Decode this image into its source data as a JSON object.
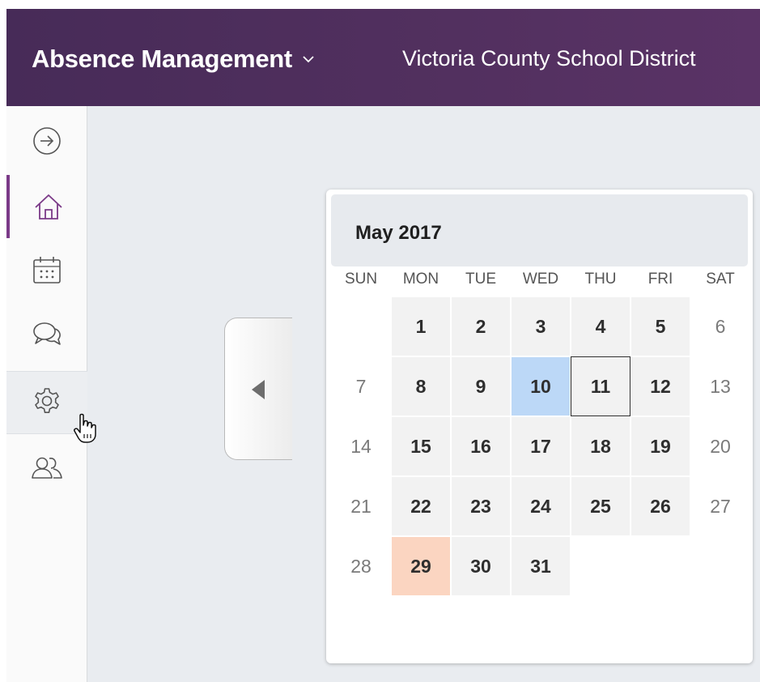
{
  "header": {
    "app_title": "Absence Management",
    "district": "Victoria County School District"
  },
  "sidebar": {
    "items": [
      {
        "icon": "arrow-right-circle-icon"
      },
      {
        "icon": "home-icon",
        "active": true
      },
      {
        "icon": "calendar-icon"
      },
      {
        "icon": "chat-icon"
      },
      {
        "icon": "gear-icon",
        "hovered": true
      },
      {
        "icon": "users-icon"
      }
    ]
  },
  "calendar": {
    "title": "May 2017",
    "weekdays": [
      "SUN",
      "MON",
      "TUE",
      "WED",
      "THU",
      "FRI",
      "SAT"
    ],
    "weeks": [
      [
        "",
        "1",
        "2",
        "3",
        "4",
        "5",
        "6"
      ],
      [
        "7",
        "8",
        "9",
        "10",
        "11",
        "12",
        "13"
      ],
      [
        "14",
        "15",
        "16",
        "17",
        "18",
        "19",
        "20"
      ],
      [
        "21",
        "22",
        "23",
        "24",
        "25",
        "26",
        "27"
      ],
      [
        "28",
        "29",
        "30",
        "31",
        "",
        "",
        ""
      ]
    ],
    "selected_day": "10",
    "today": "11",
    "marked_day": "29"
  },
  "colors": {
    "header": "#52305f",
    "accent": "#7b3a88",
    "selected": "#bcd8f7",
    "marked": "#fbd5c1"
  }
}
